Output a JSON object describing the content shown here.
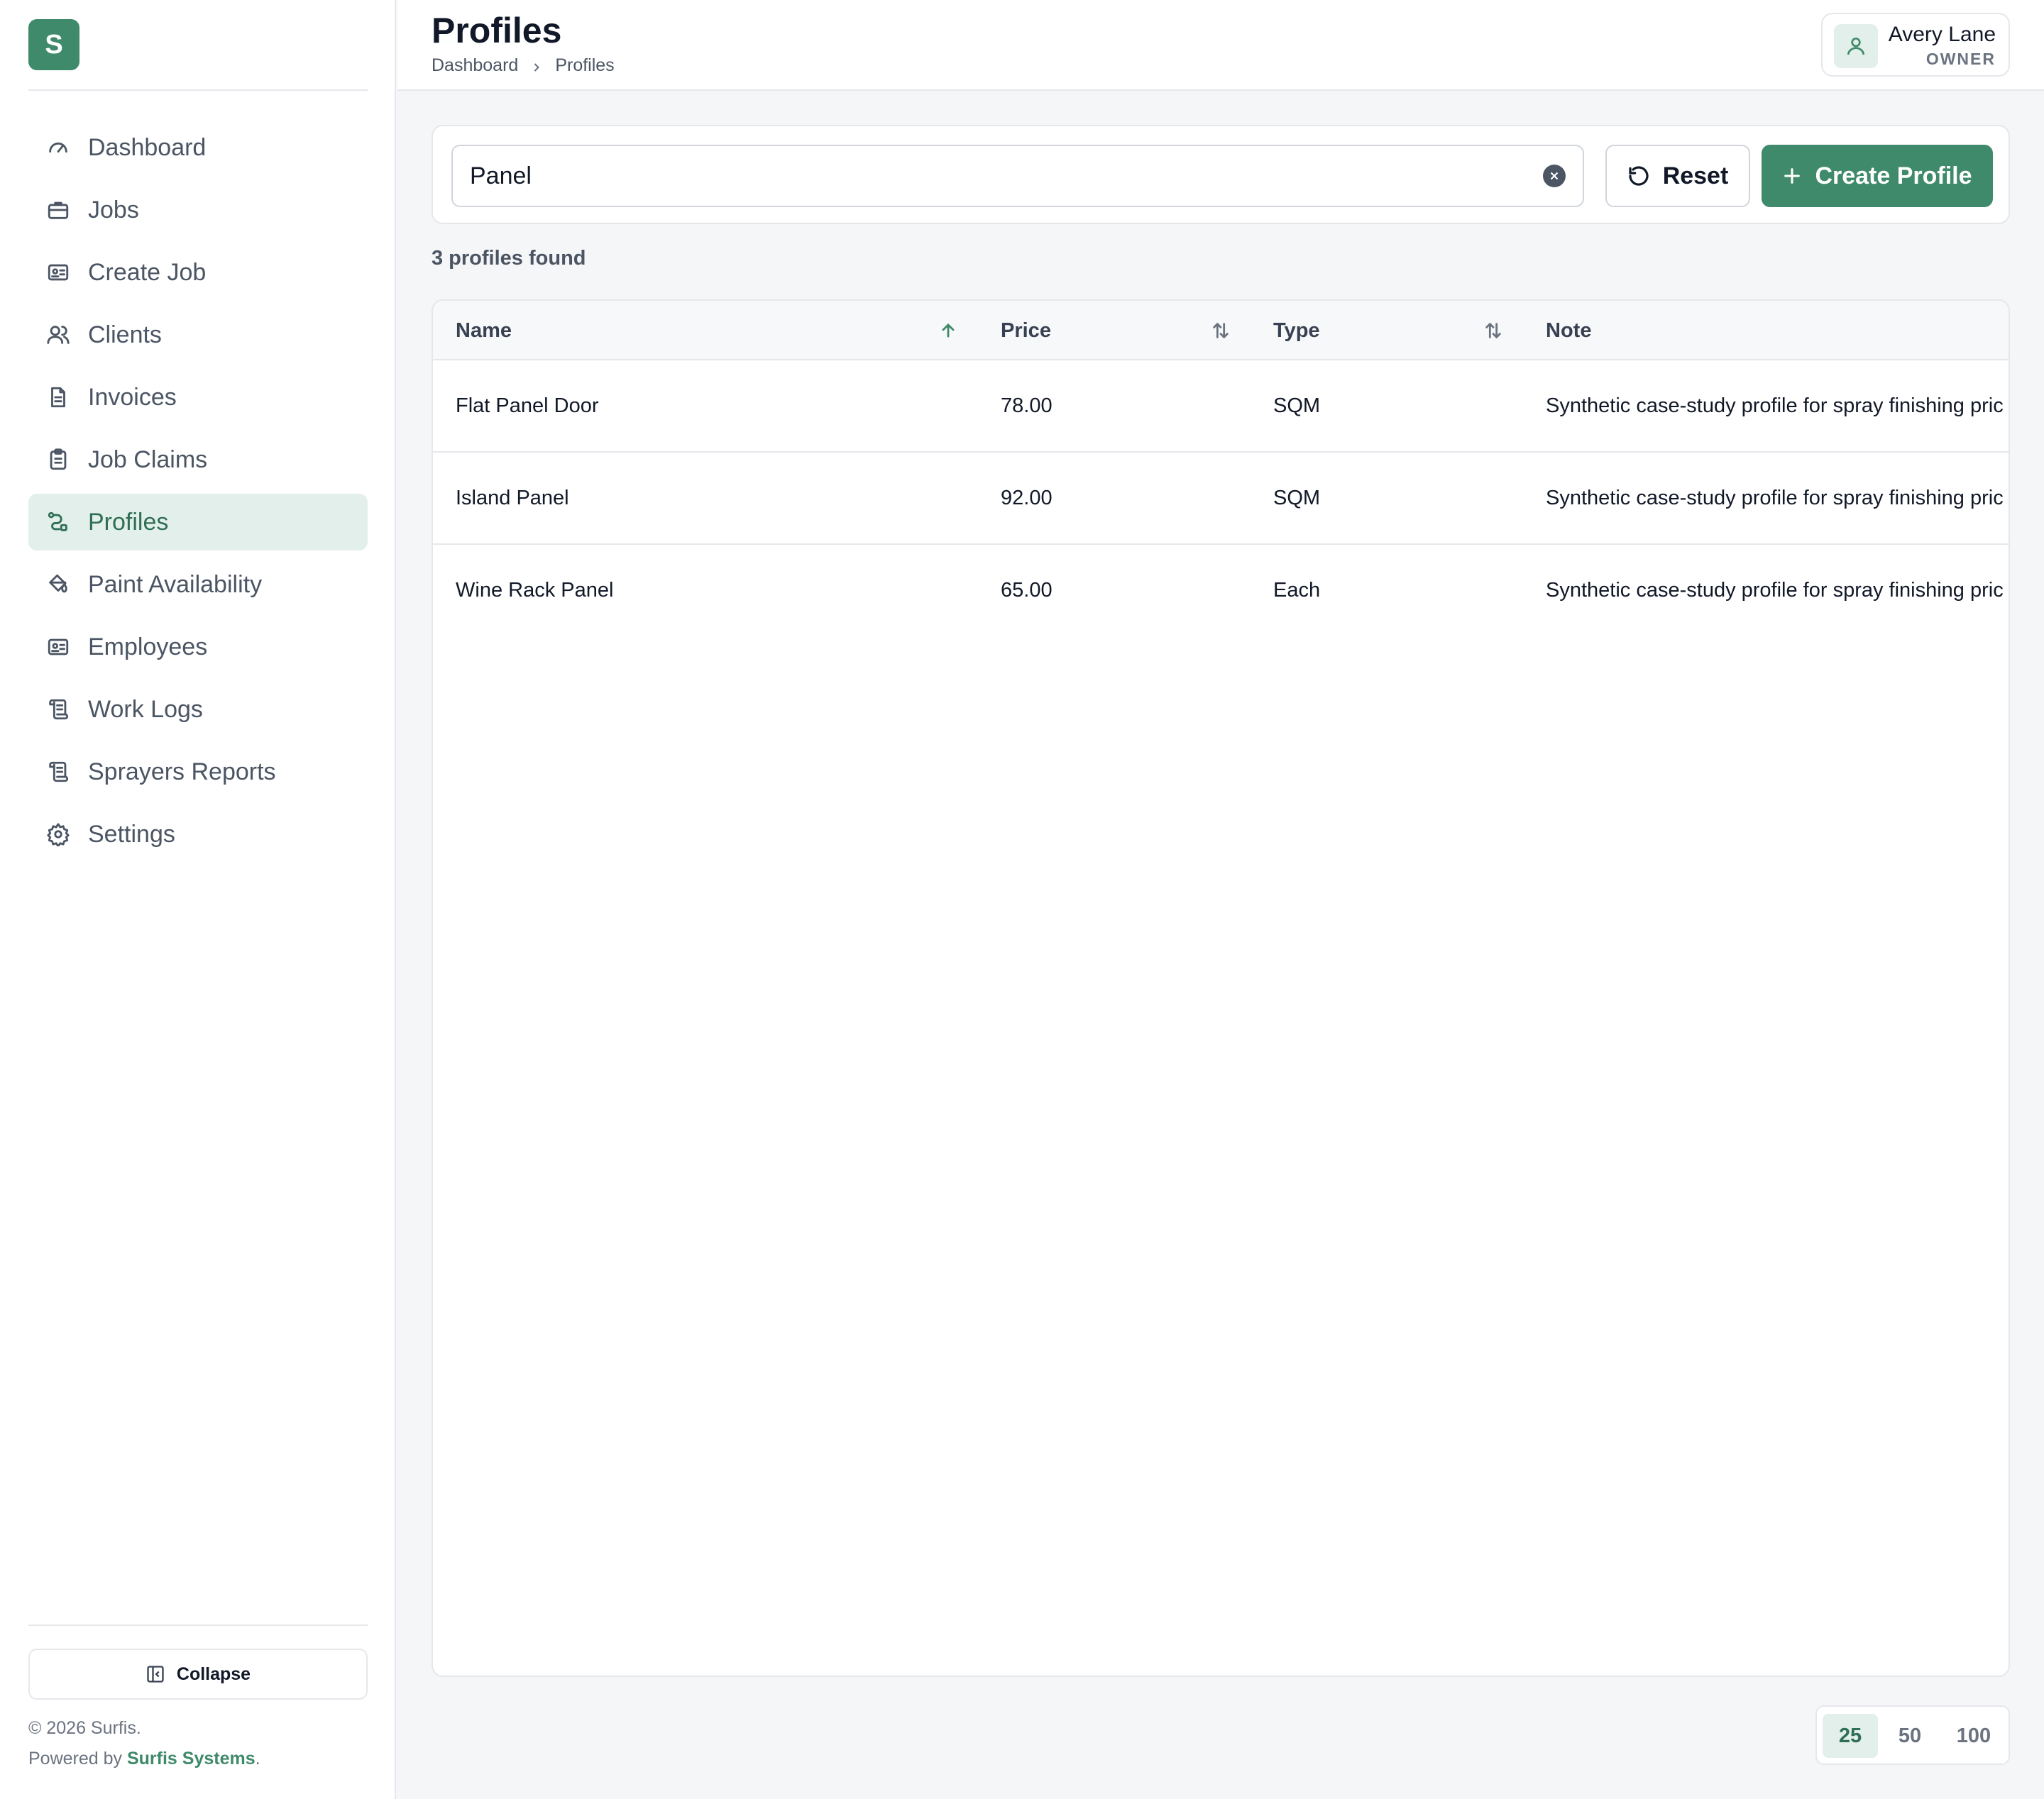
{
  "app": {
    "logo_letter": "S",
    "accent_color": "#3f8a6b"
  },
  "sidebar": {
    "items": [
      {
        "label": "Dashboard",
        "icon": "gauge-icon",
        "active": false
      },
      {
        "label": "Jobs",
        "icon": "briefcase-icon",
        "active": false
      },
      {
        "label": "Create Job",
        "icon": "id-card-icon",
        "active": false
      },
      {
        "label": "Clients",
        "icon": "users-icon",
        "active": false
      },
      {
        "label": "Invoices",
        "icon": "file-text-icon",
        "active": false
      },
      {
        "label": "Job Claims",
        "icon": "clipboard-icon",
        "active": false
      },
      {
        "label": "Profiles",
        "icon": "route-icon",
        "active": true
      },
      {
        "label": "Paint Availability",
        "icon": "paint-bucket-icon",
        "active": false
      },
      {
        "label": "Employees",
        "icon": "id-card-icon",
        "active": false
      },
      {
        "label": "Work Logs",
        "icon": "scroll-icon",
        "active": false
      },
      {
        "label": "Sprayers Reports",
        "icon": "scroll-icon",
        "active": false
      },
      {
        "label": "Settings",
        "icon": "gear-icon",
        "active": false
      }
    ],
    "collapse_label": "Collapse",
    "footer_copy": "© 2026 Surfis.",
    "footer_powered_prefix": "Powered by ",
    "footer_brand": "Surfis Systems",
    "footer_suffix": "."
  },
  "header": {
    "title": "Profiles",
    "breadcrumb": [
      "Dashboard",
      "Profiles"
    ],
    "user": {
      "name": "Avery Lane",
      "role": "OWNER"
    }
  },
  "toolbar": {
    "search_value": "Panel",
    "reset_label": "Reset",
    "create_label": "Create Profile"
  },
  "results": {
    "count_text": "3 profiles found"
  },
  "table": {
    "columns": [
      {
        "label": "Name",
        "sort": "asc"
      },
      {
        "label": "Price",
        "sort": "none"
      },
      {
        "label": "Type",
        "sort": "none"
      },
      {
        "label": "Note",
        "sort": null
      }
    ],
    "rows": [
      {
        "name": "Flat Panel Door",
        "price": "78.00",
        "type": "SQM",
        "note": "Synthetic case-study profile for spray finishing pric"
      },
      {
        "name": "Island Panel",
        "price": "92.00",
        "type": "SQM",
        "note": "Synthetic case-study profile for spray finishing pric"
      },
      {
        "name": "Wine Rack Panel",
        "price": "65.00",
        "type": "Each",
        "note": "Synthetic case-study profile for spray finishing pric"
      }
    ]
  },
  "pagination": {
    "options": [
      "25",
      "50",
      "100"
    ],
    "selected": "25"
  }
}
